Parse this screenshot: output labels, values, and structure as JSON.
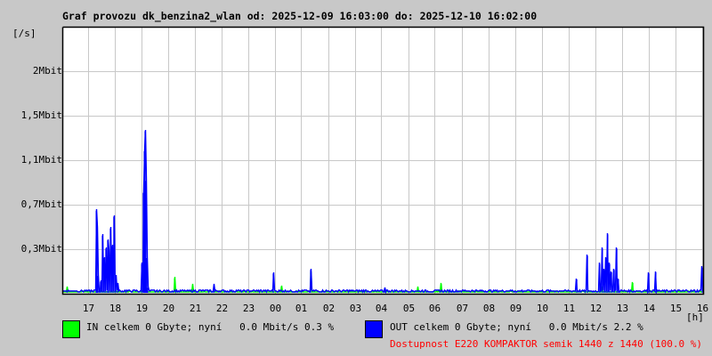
{
  "chart_data": {
    "type": "line",
    "title": "Graf provozu dk_benzina2_wlan od: 2025-12-09 16:03:00 do: 2025-12-10 16:02:00",
    "ylabel": "[/s]",
    "xlabel": "[h]",
    "x_unit": "hours since 16:03",
    "y_unit": "Mbit/s",
    "xlim": [
      0,
      24
    ],
    "ylim": [
      0,
      2.25
    ],
    "grid": true,
    "y_ticks": [
      {
        "value": 0.375,
        "label": "0,3Mbit"
      },
      {
        "value": 0.75,
        "label": "0,7Mbit"
      },
      {
        "value": 1.125,
        "label": "1,1Mbit"
      },
      {
        "value": 1.5,
        "label": "1,5Mbit"
      },
      {
        "value": 1.875,
        "label": "2Mbit"
      }
    ],
    "x_ticks": [
      "17",
      "18",
      "19",
      "20",
      "21",
      "22",
      "23",
      "00",
      "01",
      "02",
      "03",
      "04",
      "05",
      "06",
      "07",
      "08",
      "09",
      "10",
      "11",
      "12",
      "13",
      "14",
      "15",
      "16"
    ],
    "baseline": 0.012,
    "series": [
      {
        "name": "IN",
        "color": "#00ff00",
        "points": [
          [
            0.17,
            0.05
          ],
          [
            4.2,
            0.13
          ],
          [
            4.87,
            0.07
          ],
          [
            8.2,
            0.06
          ],
          [
            9.3,
            0.18
          ],
          [
            13.33,
            0.05
          ],
          [
            14.2,
            0.08
          ],
          [
            20.23,
            0.05
          ],
          [
            21.37,
            0.09
          ]
        ]
      },
      {
        "name": "OUT",
        "color": "#0000ff",
        "points": [
          [
            1.27,
            0.7
          ],
          [
            1.3,
            0.55
          ],
          [
            1.33,
            0.15
          ],
          [
            1.43,
            0.1
          ],
          [
            1.5,
            0.49
          ],
          [
            1.57,
            0.3
          ],
          [
            1.63,
            0.38
          ],
          [
            1.7,
            0.45
          ],
          [
            1.73,
            0.35
          ],
          [
            1.8,
            0.55
          ],
          [
            1.87,
            0.4
          ],
          [
            1.93,
            0.65
          ],
          [
            2.0,
            0.15
          ],
          [
            2.07,
            0.08
          ],
          [
            2.97,
            0.25
          ],
          [
            3.03,
            0.85
          ],
          [
            3.07,
            1.2
          ],
          [
            3.1,
            1.37
          ],
          [
            3.13,
            0.95
          ],
          [
            3.17,
            0.3
          ],
          [
            3.2,
            0.05
          ],
          [
            5.67,
            0.07
          ],
          [
            7.9,
            0.17
          ],
          [
            9.3,
            0.2
          ],
          [
            12.07,
            0.04
          ],
          [
            19.27,
            0.12
          ],
          [
            19.67,
            0.32
          ],
          [
            20.13,
            0.25
          ],
          [
            20.23,
            0.38
          ],
          [
            20.3,
            0.2
          ],
          [
            20.37,
            0.3
          ],
          [
            20.43,
            0.5
          ],
          [
            20.5,
            0.25
          ],
          [
            20.57,
            0.18
          ],
          [
            20.67,
            0.2
          ],
          [
            20.77,
            0.38
          ],
          [
            20.83,
            0.12
          ],
          [
            21.97,
            0.17
          ],
          [
            22.23,
            0.18
          ],
          [
            23.97,
            0.22
          ]
        ]
      }
    ]
  },
  "legend": {
    "in_text": "IN celkem 0 Gbyte; nyní   0.0 Mbit/s 0.3 %",
    "out_text": "OUT celkem 0 Gbyte; nyní   0.0 Mbit/s 2.2 %",
    "availability": "Dostupnost E220 KOMPAKTOR semik 1440 z 1440 (100.0 %)"
  }
}
